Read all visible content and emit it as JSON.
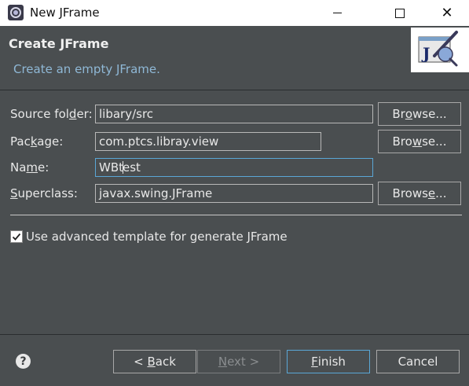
{
  "window": {
    "title": "New JFrame",
    "close_glyph": "✕"
  },
  "banner": {
    "title": "Create JFrame",
    "description": "Create an empty JFrame."
  },
  "form": {
    "source_folder": {
      "label_pre": "Source fol",
      "label_mnemonic": "d",
      "label_post": "er:",
      "value": "libary/src",
      "browse_pre": "Br",
      "browse_mnemonic": "o",
      "browse_post": "wse..."
    },
    "package": {
      "label_pre": "Pac",
      "label_mnemonic": "k",
      "label_post": "age:",
      "value": "com.ptcs.libray.view",
      "browse_pre": "Bro",
      "browse_mnemonic": "w",
      "browse_post": "se..."
    },
    "name": {
      "label_pre": "Na",
      "label_mnemonic": "m",
      "label_post": "e:",
      "value_before_caret": "WBt",
      "value_after_caret": "est"
    },
    "superclass": {
      "label_pre": "",
      "label_mnemonic": "S",
      "label_post": "uperclass:",
      "value": "javax.swing.JFrame",
      "browse_pre": "Brows",
      "browse_mnemonic": "e",
      "browse_post": "..."
    },
    "advanced_template": {
      "label": "Use advanced template for generate JFrame",
      "checked": true
    }
  },
  "footer": {
    "help_glyph": "?",
    "back": {
      "pre": "< ",
      "mnemonic": "B",
      "post": "ack"
    },
    "next": {
      "pre": "",
      "mnemonic": "N",
      "post": "ext >"
    },
    "finish": {
      "pre": "",
      "mnemonic": "F",
      "post": "inish"
    },
    "cancel": "Cancel"
  },
  "colors": {
    "background": "#4a4e50",
    "focus_border": "#5aa7d6",
    "description": "#8fb8d6"
  },
  "icons": {
    "app": "eclipse-windowbuilder-icon",
    "banner": "jframe-wizard-icon",
    "help": "help-icon",
    "checkbox": "checkmark-icon"
  }
}
